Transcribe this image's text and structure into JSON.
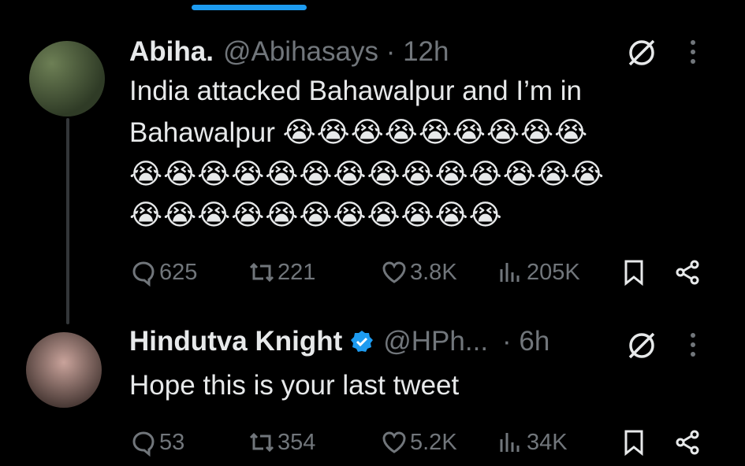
{
  "tweet1": {
    "name": "Abiha.",
    "handle": "@Abihasays · 12h",
    "text_line1": "India attacked Bahawalpur and I’m in",
    "text_line2": "Bahawalpur",
    "emojis_line1": "😭😭😭😭😭😭😭😭😭",
    "emojis_line2": "😭😭😭😭😭😭😭😭😭😭😭😭😭😭",
    "emojis_line3": "😭😭😭😭😭😭😭😭😭😭😭",
    "replies": "625",
    "reposts": "221",
    "likes": "3.8K",
    "views": "205K"
  },
  "tweet2": {
    "name": "Hindutva Knight",
    "handle": "@HPh...",
    "time": "· 6h",
    "text": "Hope this is your last tweet",
    "replies": "53",
    "reposts": "354",
    "likes": "5.2K",
    "views": "34K"
  },
  "colors": {
    "accent": "#1d9bf0",
    "muted": "#71767b",
    "text": "#e7e9ea",
    "background": "#000000"
  },
  "icons": [
    "reply-icon",
    "repost-icon",
    "like-icon",
    "views-icon",
    "bookmark-icon",
    "share-icon",
    "grok-icon",
    "more-icon",
    "verified-badge-icon"
  ]
}
